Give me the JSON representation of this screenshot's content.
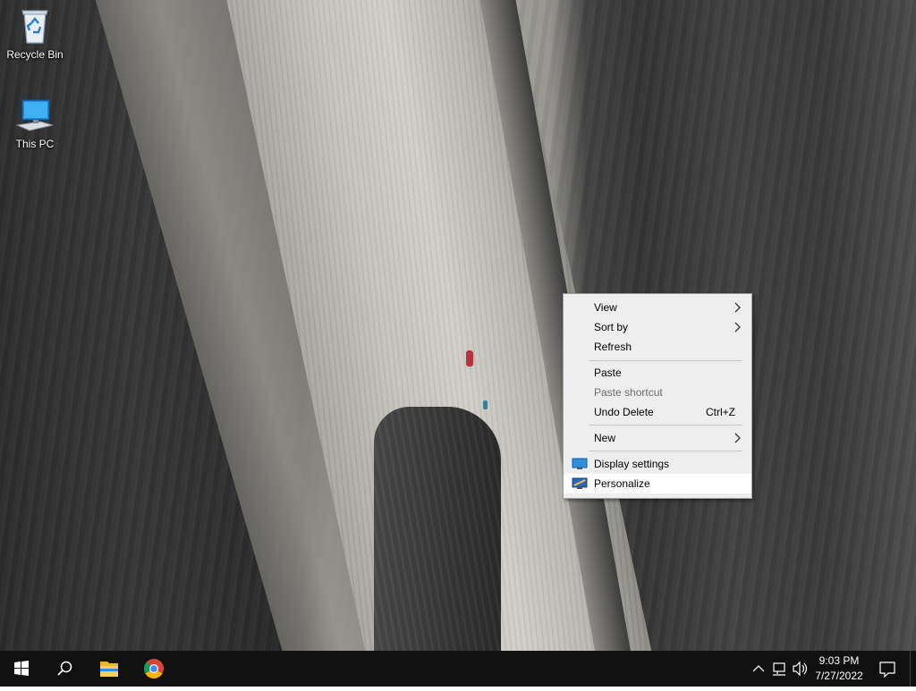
{
  "desktop": {
    "icons": [
      {
        "label": "Recycle Bin",
        "icon": "recycle-bin-icon"
      },
      {
        "label": "This PC",
        "icon": "this-pc-icon"
      }
    ]
  },
  "context_menu": {
    "items": {
      "view": {
        "label": "View",
        "submenu": true
      },
      "sort_by": {
        "label": "Sort by",
        "submenu": true
      },
      "refresh": {
        "label": "Refresh"
      },
      "paste": {
        "label": "Paste"
      },
      "paste_shortcut": {
        "label": "Paste shortcut",
        "disabled": true
      },
      "undo_delete": {
        "label": "Undo Delete",
        "shortcut": "Ctrl+Z"
      },
      "new": {
        "label": "New",
        "submenu": true
      },
      "display_settings": {
        "label": "Display settings",
        "icon": "display-settings-icon"
      },
      "personalize": {
        "label": "Personalize",
        "icon": "personalize-icon",
        "highlighted": true
      }
    }
  },
  "taskbar": {
    "start": "windows-logo-icon",
    "search": "search-icon",
    "pinned": [
      "file-explorer-icon",
      "chrome-icon"
    ],
    "tray_icons": [
      "chevron-up-icon",
      "network-icon",
      "volume-icon"
    ],
    "clock": {
      "time": "9:03 PM",
      "date": "7/27/2022"
    },
    "notifications": "action-center-icon"
  },
  "colors": {
    "taskbar_bg": "#101010",
    "menu_bg": "#eeeeee",
    "menu_highlight": "#ffffff",
    "disabled_text": "#6d6d6d"
  }
}
